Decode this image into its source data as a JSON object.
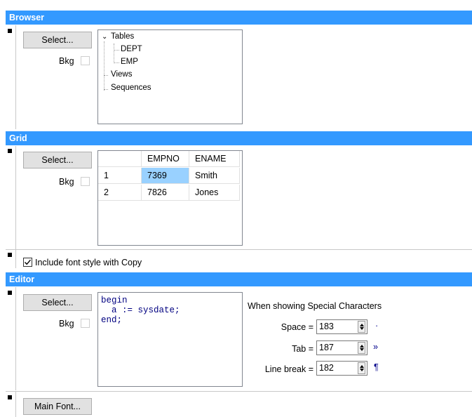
{
  "sections": {
    "browser": {
      "title": "Browser",
      "select_label": "Select...",
      "bkg_label": "Bkg"
    },
    "grid": {
      "title": "Grid",
      "select_label": "Select...",
      "bkg_label": "Bkg"
    },
    "editor": {
      "title": "Editor",
      "select_label": "Select...",
      "bkg_label": "Bkg"
    }
  },
  "tree": {
    "tables": "Tables",
    "dept": "DEPT",
    "emp": "EMP",
    "views": "Views",
    "sequences": "Sequences"
  },
  "grid_table": {
    "columns": [
      "",
      "EMPNO",
      "ENAME"
    ],
    "rows": [
      [
        "1",
        "7369",
        "Smith"
      ],
      [
        "2",
        "7826",
        "Jones"
      ]
    ]
  },
  "include_font_style": {
    "label": "Include font style with Copy",
    "checked": true
  },
  "editor_code": {
    "line1": "begin",
    "line2": "  a := sysdate;",
    "line3": "end;"
  },
  "special_chars": {
    "heading": "When showing Special Characters",
    "space": {
      "label": "Space =",
      "value": "183",
      "glyph": "·"
    },
    "tab": {
      "label": "Tab =",
      "value": "187",
      "glyph": "»"
    },
    "line_break": {
      "label": "Line break =",
      "value": "182",
      "glyph": "¶"
    }
  },
  "main_font_label": "Main Font...",
  "colors": {
    "band": "#3399ff",
    "selection": "#99d1ff",
    "code_text": "#000080"
  }
}
